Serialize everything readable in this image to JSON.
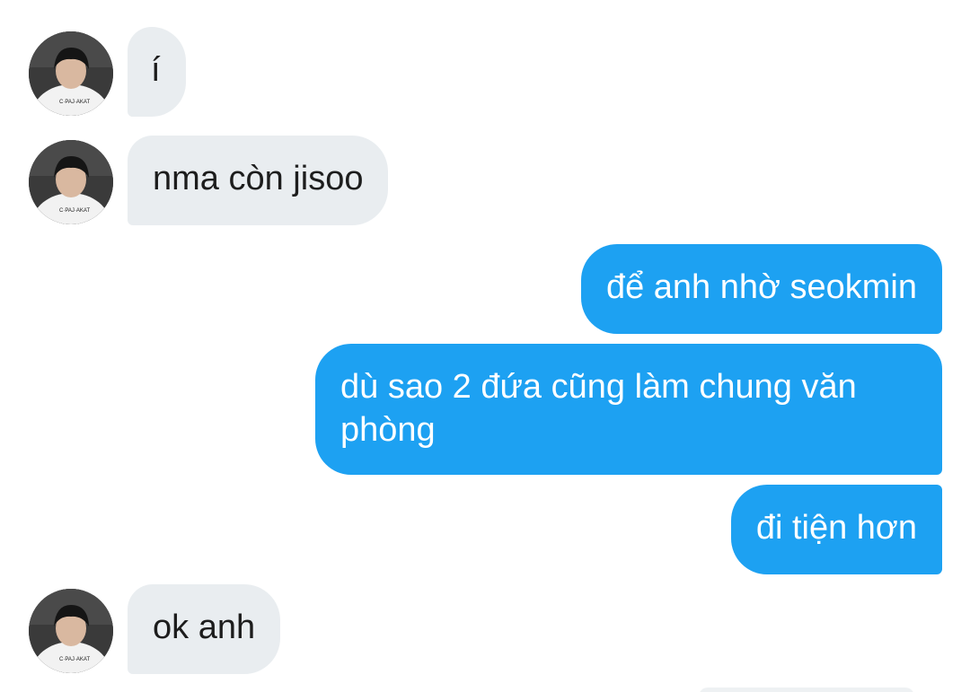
{
  "messages": [
    {
      "side": "in",
      "text": "í"
    },
    {
      "side": "in",
      "text": "nma còn jisoo"
    },
    {
      "side": "out",
      "text": "để anh nhờ seokmin"
    },
    {
      "side": "out",
      "text": "dù sao 2 đứa cũng làm chung văn phòng"
    },
    {
      "side": "out",
      "text": "đi tiện hơn"
    },
    {
      "side": "in",
      "text": "ok anh"
    }
  ],
  "colors": {
    "incoming_bubble": "#e9edf0",
    "outgoing_bubble": "#1da1f2",
    "background": "#ffffff"
  },
  "avatar_shirt_text": "C·PAJ·AKAT"
}
